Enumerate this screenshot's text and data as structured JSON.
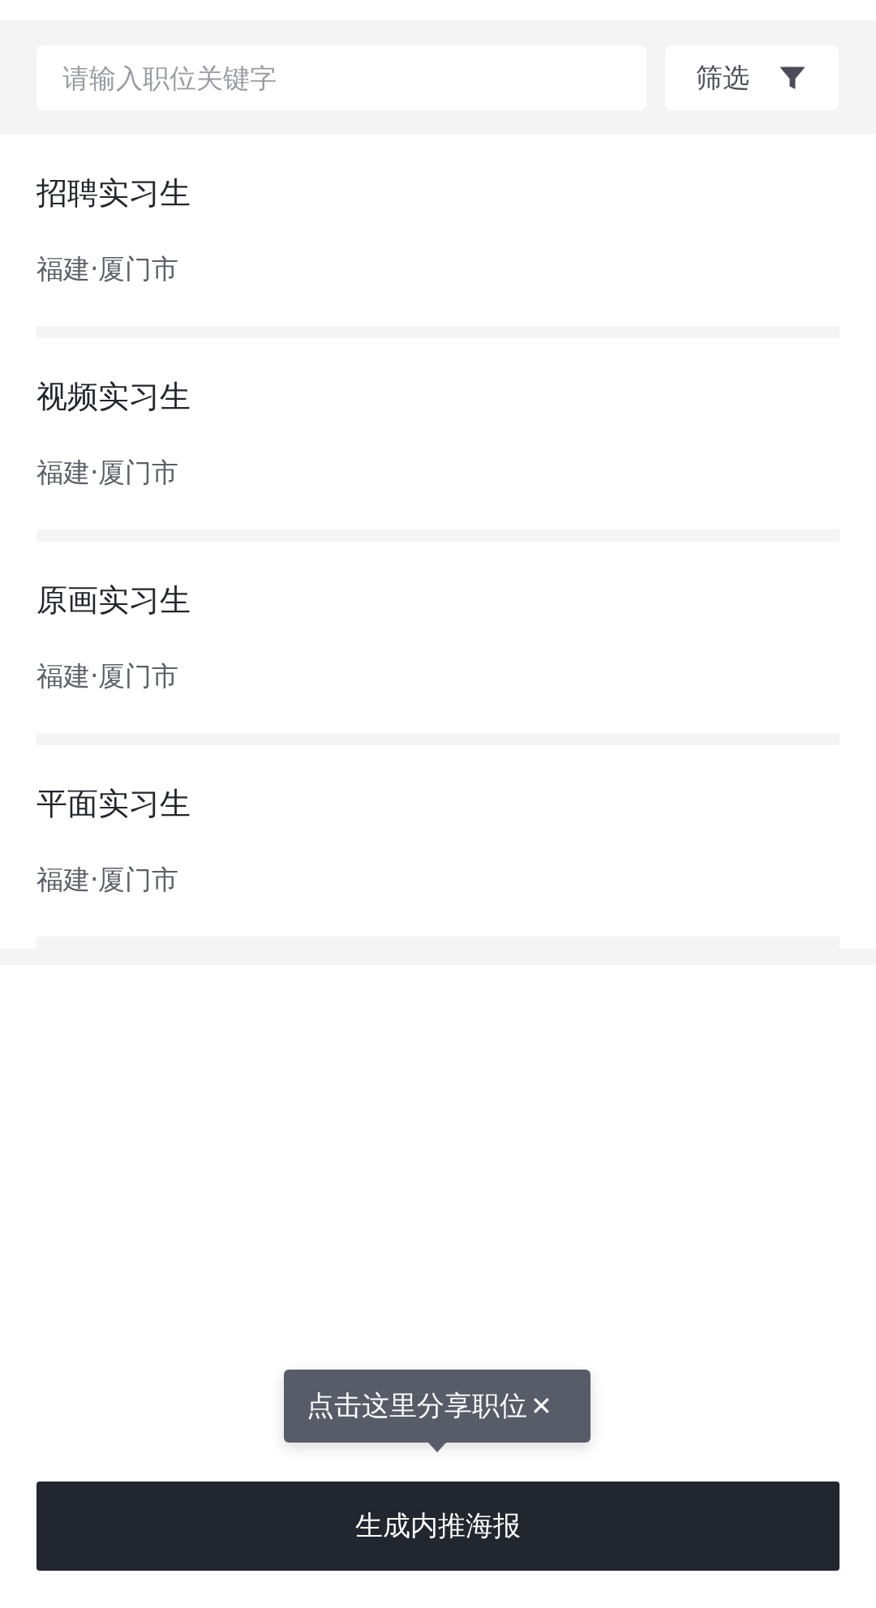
{
  "search": {
    "placeholder": "请输入职位关键字"
  },
  "filter_button": {
    "label": "筛选"
  },
  "jobs": [
    {
      "title": "招聘实习生",
      "location": "福建·厦门市"
    },
    {
      "title": "视频实习生",
      "location": "福建·厦门市"
    },
    {
      "title": "原画实习生",
      "location": "福建·厦门市"
    },
    {
      "title": "平面实习生",
      "location": "福建·厦门市"
    }
  ],
  "tooltip": {
    "text": "点击这里分享职位",
    "close": "✕"
  },
  "primary_button": {
    "label": "生成内推海报"
  }
}
